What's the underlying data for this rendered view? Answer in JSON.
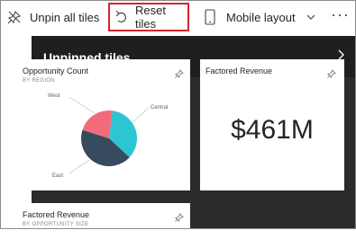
{
  "toolbar": {
    "unpin_label": "Unpin all tiles",
    "reset_label": "Reset tiles",
    "mobile_label": "Mobile layout",
    "more_label": "···"
  },
  "panel": {
    "title": "Unpinned tiles"
  },
  "tiles": [
    {
      "title": "Opportunity Count",
      "subtitle": "BY REGION",
      "chart_labels": {
        "west": "West",
        "central": "Central",
        "east": "East"
      }
    },
    {
      "title": "Factored Revenue",
      "value": "$461M"
    },
    {
      "title": "Factored Revenue",
      "subtitle": "BY OPPORTUNITY SIZE"
    }
  ],
  "chart_data": {
    "type": "pie",
    "categories": [
      "Central",
      "East",
      "West"
    ],
    "values": [
      35,
      43,
      22
    ],
    "colors": [
      "#2ec5d3",
      "#374a5e",
      "#f26b7a"
    ]
  },
  "colors": {
    "highlight": "#d4252d",
    "panel_bg": "#2b2b2b",
    "header_bg": "#1f1f1f"
  }
}
